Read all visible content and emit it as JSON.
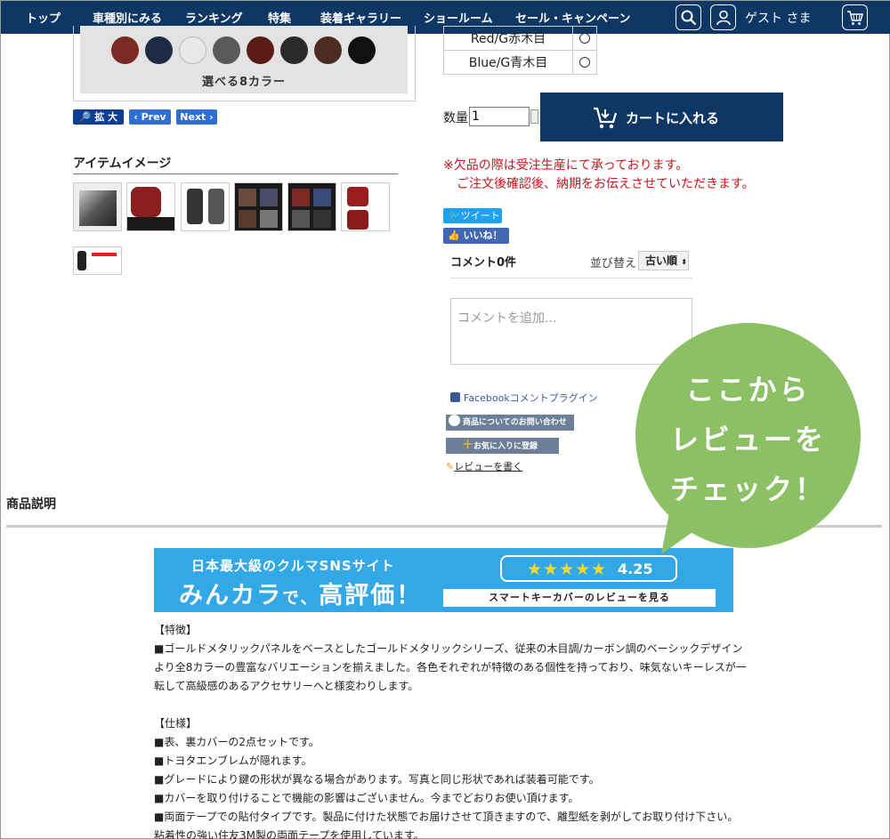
{
  "nav": {
    "items": [
      "トップ",
      "車種別にみる",
      "ランキング",
      "特集",
      "装着ギャラリー",
      "ショールーム",
      "セール・キャンペーン"
    ],
    "guest_label": "ゲスト さま",
    "icons": [
      "search-icon",
      "user-icon",
      "cart-icon"
    ]
  },
  "product_image": {
    "caption": "選べる8カラー",
    "swatch_colors": [
      "#7a2a22",
      "#1f2a45",
      "#e8e8e8",
      "#5a5a5a",
      "#5a1d16",
      "#2a2a2a",
      "#4a2c22",
      "#111111"
    ]
  },
  "image_controls": {
    "zoom_label": "拡 大",
    "prev_label": "‹ Prev",
    "next_label": "Next ›"
  },
  "item_images": {
    "heading": "アイテムイメージ",
    "thumb_count": 7
  },
  "color_options": [
    {
      "name": "Red/G赤木目"
    },
    {
      "name": "Blue/G青木目"
    }
  ],
  "purchase": {
    "qty_label": "数量",
    "qty_value": "1",
    "cart_label": "カートに入れる",
    "notice_line1": "※欠品の際は受注生産にて承っております。",
    "notice_line2": "ご注文後確認後、納期をお伝えさせていただきます。"
  },
  "social": {
    "tweet_label": "ツイート",
    "like_label": "いいね！ 0"
  },
  "comments": {
    "count_label": "コメント0件",
    "sort_label": "並び替え",
    "sort_value": "古い順",
    "placeholder": "コメントを追加...",
    "plugin_label": "Facebookコメントプラグイン"
  },
  "actions": {
    "inquiry_label": "商品についてのお問い合わせ",
    "favorite_label": "お気に入りに登録",
    "review_label": "レビューを書く"
  },
  "bubble": {
    "line1": "ここから",
    "line2": "レビューを",
    "line3": "チェック！"
  },
  "description": {
    "title": "商品説明",
    "banner": {
      "top": "日本最大級のクルマSNSサイト",
      "main_a": "みんカラ",
      "main_b": "で、",
      "main_c": "高評価！",
      "stars": "★★★★★",
      "rating": "4.25",
      "cta": "スマートキーカバーのレビューを見る"
    },
    "features_heading": "【特徴】",
    "features": [
      "■ゴールドメタリックパネルをベースとしたゴールドメタリックシリーズ、従来の木目調/カーボン調のベーシックデザイン",
      "より全8カラーの豊富なバリエーションを揃えました。各色それぞれが特徴のある個性を持っており、味気ないキーレスが一",
      "転して高級感のあるアクセサリーへと様変わりします。"
    ],
    "spec_heading": "【仕様】",
    "specs": [
      "■表、裏カバーの2点セットです。",
      "■トヨタエンブレムが隠れます。",
      "■グレードにより鍵の形状が異なる場合があります。写真と同じ形状であれば装着可能です。",
      "■カバーを取り付けることで機能の影響はございません。今までどおりお使い頂けます。",
      "■両面テープでの貼付タイプです。製品に付けた状態でお届けさせて頂きますので、離型紙を剥がしてお取り付け下さい。",
      "粘着性の強い住友3M製の両面テープを使用しています。"
    ]
  }
}
